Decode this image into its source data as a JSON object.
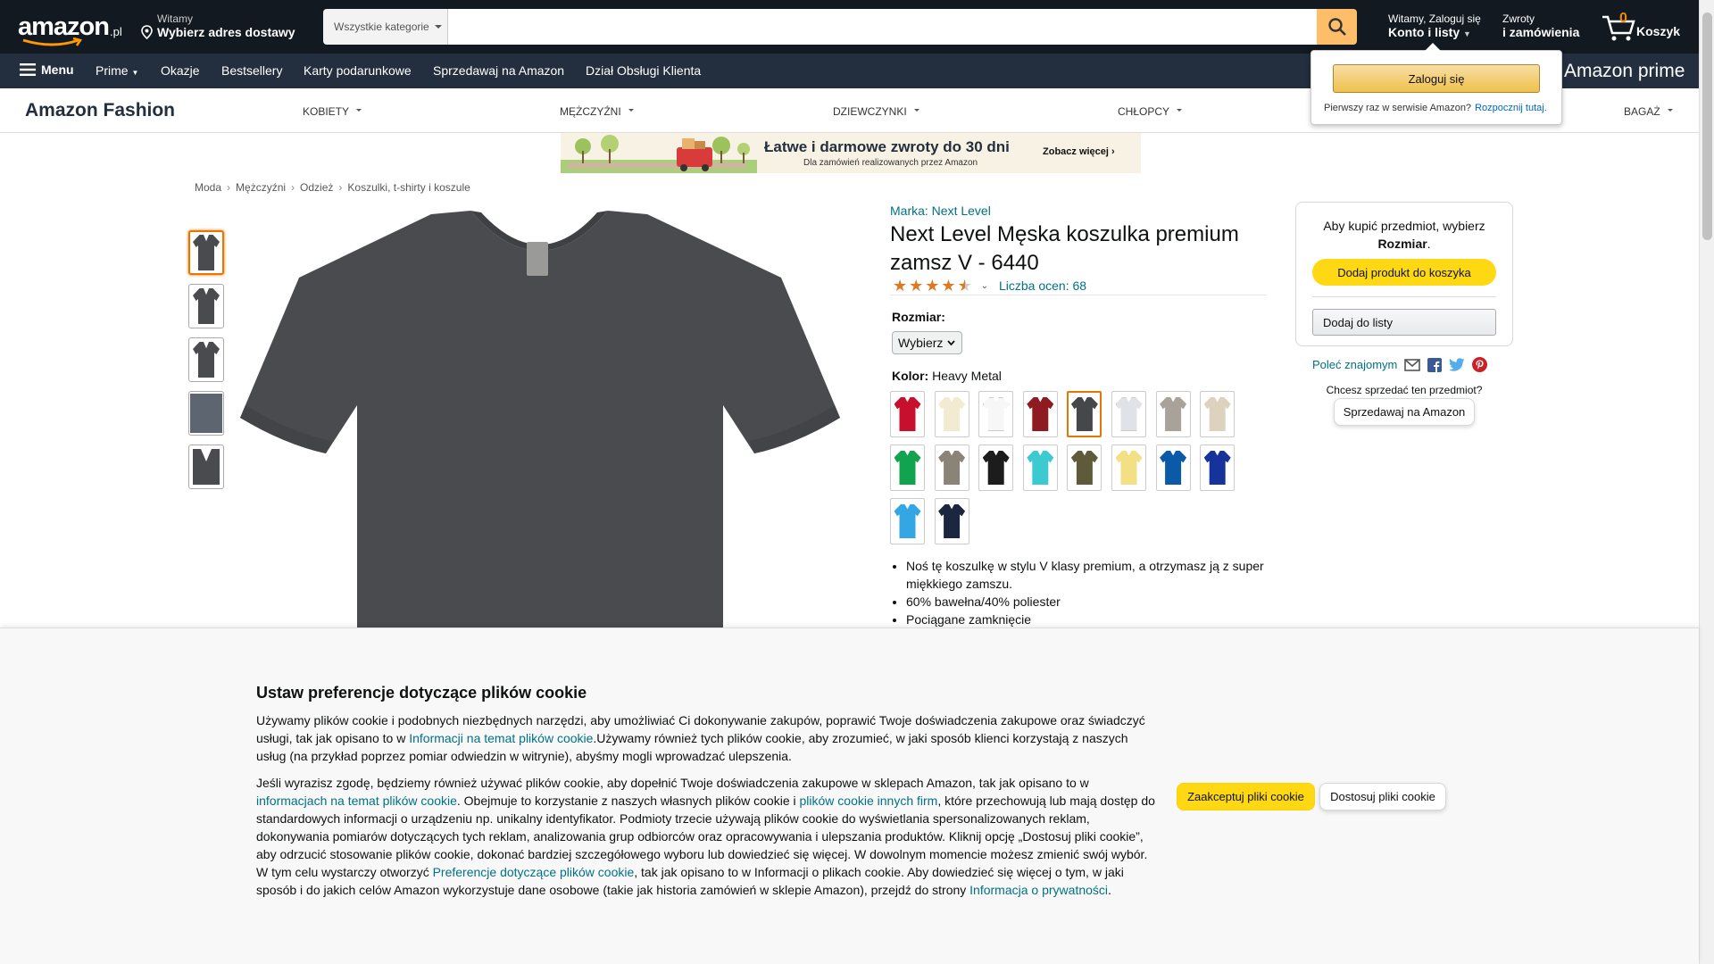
{
  "header": {
    "logo_text": "amazon",
    "logo_tld": ".pl",
    "deliver_greeting": "Witamy",
    "deliver_label": "Wybierz adres dostawy",
    "search_category": "Wszystkie kategorie",
    "search_placeholder": "",
    "account_greeting": "Witamy, Zaloguj się",
    "account_label": "Konto i listy",
    "returns_line1": "Zwroty",
    "returns_line2": "i zamówienia",
    "cart_count": "0",
    "cart_label": "Koszyk"
  },
  "subnav": {
    "menu": "Menu",
    "items": [
      "Prime",
      "Okazje",
      "Bestsellery",
      "Karty podarunkowe",
      "Sprzedawaj na Amazon",
      "Dział Obsługi Klienta"
    ],
    "prime_logo": "Amazon prime"
  },
  "fashion": {
    "logo": "Amazon Fashion",
    "categories": [
      "KOBIETY",
      "MĘŻCZYŹNI",
      "DZIEWCZYNKI",
      "CHŁOPCY",
      "BAGAŻ"
    ]
  },
  "banner": {
    "headline": "Łatwe i darmowe zwroty do 30 dni",
    "subline": "Dla zamówień realizowanych przez Amazon",
    "cta": "Zobacz więcej ›"
  },
  "breadcrumb": [
    "Moda",
    "Mężczyźni",
    "Odzież",
    "Koszulki, t-shirty i koszule"
  ],
  "product": {
    "brand": "Marka: Next Level",
    "title": "Next Level Męska koszulka premium zamsz V - 6440",
    "rating": 4.5,
    "ratings_count": "Liczba ocen: 68",
    "size_label": "Rozmiar:",
    "size_value": "Wybierz",
    "color_label": "Kolor:",
    "color_value": "Heavy Metal",
    "main_color": "#4a4b4e",
    "swatches": [
      {
        "name": "swatch-red",
        "color": "#c8102e"
      },
      {
        "name": "swatch-cream",
        "color": "#f3ead2"
      },
      {
        "name": "swatch-white",
        "color": "#f7f7f7"
      },
      {
        "name": "swatch-cardinal",
        "color": "#8e1b22"
      },
      {
        "name": "swatch-heavy-metal",
        "color": "#45474a"
      },
      {
        "name": "swatch-light-gray",
        "color": "#dfe3e8"
      },
      {
        "name": "swatch-heather-gray",
        "color": "#a9a29b"
      },
      {
        "name": "swatch-sand",
        "color": "#ddd2bd"
      },
      {
        "name": "swatch-kelly-green",
        "color": "#12a34e"
      },
      {
        "name": "swatch-warm-gray",
        "color": "#8a8378"
      },
      {
        "name": "swatch-black",
        "color": "#1c1c1c"
      },
      {
        "name": "swatch-turquoise",
        "color": "#3cc9d0"
      },
      {
        "name": "swatch-military-green",
        "color": "#5e5b3a"
      },
      {
        "name": "swatch-banana-cream",
        "color": "#f3df84"
      },
      {
        "name": "swatch-royal",
        "color": "#0b5aa8"
      },
      {
        "name": "swatch-cobalt",
        "color": "#16339b"
      },
      {
        "name": "swatch-light-blue",
        "color": "#35a6e4"
      },
      {
        "name": "swatch-midnight-navy",
        "color": "#1b2640"
      }
    ],
    "bullets": [
      "Noś tę koszulkę w stylu V klasy premium, a otrzymasz ją z super miękkiego zamszu.",
      "60% bawełna/40% poliester",
      "Pociągane zamknięcie"
    ]
  },
  "buybox": {
    "msg_part1": "Aby kupić przedmiot, wybierz",
    "msg_bold": "Rozmiar",
    "msg_end": ".",
    "add_to_cart": "Dodaj produkt do koszyka",
    "add_to_list": "Dodaj do listy",
    "share_label": "Poleć znajomym",
    "sell_question": "Chcesz sprzedać ten przedmiot?",
    "sell_button": "Sprzedawaj na Amazon"
  },
  "flyout": {
    "signin": "Zaloguj się",
    "new_customer": "Pierwszy raz w serwisie Amazon?",
    "start_here": "Rozpocznij tutaj."
  },
  "cookie": {
    "title": "Ustaw preferencje dotyczące plików cookie",
    "p1_a": "Używamy plików cookie i podobnych niezbędnych narzędzi, aby umożliwiać Ci dokonywanie zakupów, poprawić Twoje doświadczenia zakupowe oraz świadczyć usługi, tak jak opisano to w ",
    "p1_link": "Informacji na temat plików cookie",
    "p1_b": ".Używamy również tych plików cookie, aby zrozumieć, w jaki sposób klienci korzystają z naszych usług (na przykład poprzez pomiar odwiedzin w witrynie), abyśmy mogli wprowadzać ulepszenia.",
    "p2_a": "Jeśli wyrazisz zgodę, będziemy również używać plików cookie, aby dopełnić Twoje doświadczenia zakupowe w sklepach Amazon, tak jak opisano to w ",
    "p2_link1": "informacjach na temat plików cookie",
    "p2_b": ". Obejmuje to korzystanie z naszych własnych plików cookie i ",
    "p2_link2": "plików cookie innych firm",
    "p2_c": ", które przechowują lub mają dostęp do standardowych informacji o urządzeniu np. unikalny identyfikator. Podmioty trzecie używają plików cookie do wyświetlania spersonalizowanych reklam, dokonywania pomiarów dotyczących tych reklam, analizowania grup odbiorców oraz opracowywania i ulepszania produktów. Kliknij opcję „Dostosuj pliki cookie”, aby odrzucić stosowanie plików cookie, dokonać bardziej szczegółowego wyboru lub dowiedzieć się więcej. W dowolnym momencie możesz zmienić swój wybór. W tym celu wystarczy otworzyć ",
    "p2_link3": "Preferencje dotyczące plików cookie",
    "p2_d": ", tak jak opisano to w Informacji o plikach cookie. Aby dowiedzieć się więcej o tym, w jaki sposób i do jakich celów Amazon wykorzystuje dane osobowe (takie jak historia zamówień w sklepie Amazon), przejdź do strony ",
    "p2_link4": "Informacja o prywatności",
    "p2_e": ".",
    "accept": "Zaakceptuj pliki cookie",
    "customize": "Dostosuj pliki cookie"
  }
}
